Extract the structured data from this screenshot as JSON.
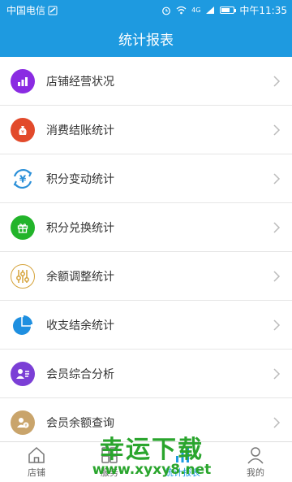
{
  "status_bar": {
    "carrier": "中国电信",
    "network": "4G",
    "time": "中午11:35"
  },
  "header": {
    "title": "统计报表"
  },
  "menu": [
    {
      "label": "店铺经营状况",
      "icon": "bar-chart-icon",
      "color": "#8a2be2"
    },
    {
      "label": "消费结账统计",
      "icon": "money-bag-icon",
      "color": "#e24a2b"
    },
    {
      "label": "积分变动统计",
      "icon": "yen-exchange-icon",
      "color": "#2a8fd8"
    },
    {
      "label": "积分兑换统计",
      "icon": "gift-icon",
      "color": "#22b42a"
    },
    {
      "label": "余额调整统计",
      "icon": "adjust-icon",
      "color": "#d5a33b"
    },
    {
      "label": "收支结余统计",
      "icon": "pie-chart-icon",
      "color": "#1e8fe0"
    },
    {
      "label": "会员综合分析",
      "icon": "member-card-icon",
      "color": "#7b3fd6"
    },
    {
      "label": "会员余额查询",
      "icon": "member-balance-icon",
      "color": "#c9a46b"
    }
  ],
  "tabs": [
    {
      "label": "店铺",
      "icon": "home-icon",
      "active": false
    },
    {
      "label": "服务",
      "icon": "grid-icon",
      "active": false
    },
    {
      "label": "统计报表",
      "icon": "chart-icon",
      "active": true
    },
    {
      "label": "我的",
      "icon": "person-icon",
      "active": false
    }
  ],
  "watermark": {
    "main": "幸运下载",
    "sub": "www.xyxy8.net"
  },
  "colors": {
    "primary": "#1e9ae0",
    "background": "#f0f0f0"
  }
}
